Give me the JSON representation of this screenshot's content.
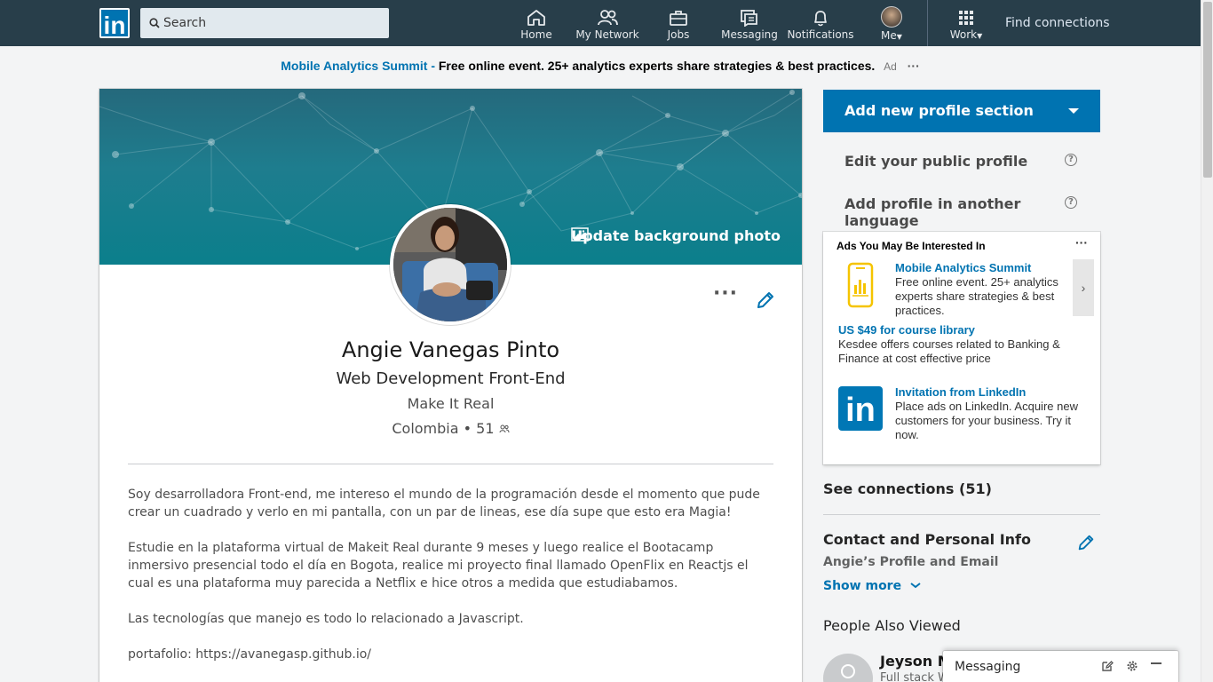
{
  "nav": {
    "logo_text": "in",
    "search_placeholder": "Search",
    "items": [
      {
        "label": "Home",
        "icon": "home-icon"
      },
      {
        "label": "My Network",
        "icon": "network-icon"
      },
      {
        "label": "Jobs",
        "icon": "briefcase-icon"
      },
      {
        "label": "Messaging",
        "icon": "messaging-icon"
      },
      {
        "label": "Notifications",
        "icon": "bell-icon"
      },
      {
        "label": "Me",
        "icon": "avatar"
      },
      {
        "label": "Work",
        "icon": "grid-icon"
      }
    ],
    "find_connections": "Find connections"
  },
  "ad_banner": {
    "title": "Mobile Analytics Summit -",
    "desc": "Free online event. 25+ analytics experts share strategies & best practices.",
    "ad_label": "Ad",
    "more": "···"
  },
  "profile": {
    "update_bg": "Update background photo",
    "name": "Angie Vanegas Pinto",
    "headline": "Web Development Front-End",
    "company": "Make It Real",
    "location": "Colombia",
    "connections": "51",
    "summary": [
      "Soy desarrolladora Front-end, me intereso el mundo de la programación desde el momento que pude crear un cuadrado y verlo en mi pantalla, con un par de lineas, ese día supe que esto era Magia!",
      "Estudie en la plataforma virtual de Makeit Real durante 9 meses y luego realice el Bootacamp inmersivo presencial todo el día en Bogota, realice mi proyecto final llamado OpenFlix en Reactjs el cual es una plataforma muy parecida a Netflix e hice otros a medida que estudiabamos.",
      "Las tecnologías que manejo es todo lo relacionado a Javascript.",
      "portafolio: https://avanegasp.github.io/"
    ]
  },
  "rail": {
    "add_section": "Add new profile section",
    "edit_public": "Edit your public profile",
    "add_language": "Add profile in another language",
    "ads": {
      "title": "Ads You May Be Interested In",
      "items": [
        {
          "title": "Mobile Analytics Summit",
          "desc": "Free online event. 25+ analytics experts share strategies & best practices."
        },
        {
          "title": "US $49 for course library",
          "desc": "Kesdee offers courses related to Banking & Finance at cost effective price"
        },
        {
          "title": "Invitation from LinkedIn",
          "desc": "Place ads on LinkedIn. Acquire new customers for your business. Try it now."
        }
      ]
    },
    "see_connections": "See connections (51)",
    "contact_title": "Contact and Personal Info",
    "contact_sub": "Angie’s Profile and Email",
    "show_more": "Show more",
    "people_also_viewed": "People Also Viewed",
    "pv_name": "Jeyson Mo",
    "pv_headline": "Full stack W"
  },
  "messaging": {
    "label": "Messaging"
  },
  "colors": {
    "nav_bg": "#283e4a",
    "brand_blue": "#0073b1",
    "page_bg": "#f3f4f5"
  }
}
